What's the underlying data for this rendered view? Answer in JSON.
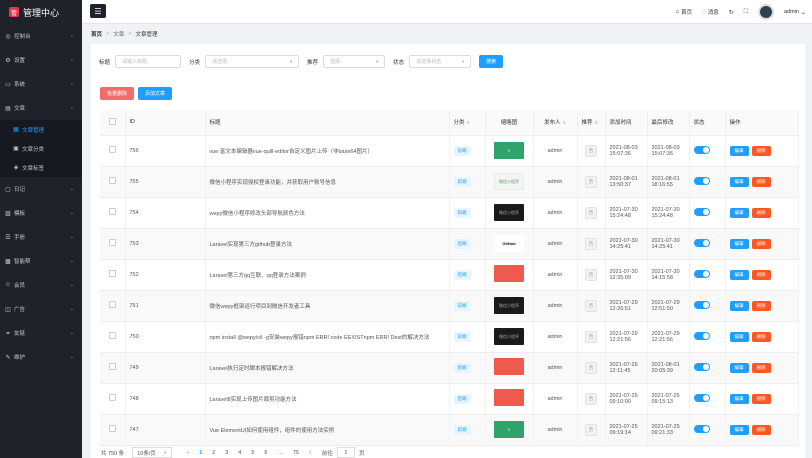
{
  "app": {
    "title": "管理中心",
    "logo_char": "管"
  },
  "sidebar": {
    "items": [
      {
        "icon": "dashboard-icon",
        "glyph": "◎",
        "label": "控制台"
      },
      {
        "icon": "settings-icon",
        "glyph": "⚙",
        "label": "设置"
      },
      {
        "icon": "monitor-icon",
        "glyph": "▭",
        "label": "系统"
      },
      {
        "icon": "article-icon",
        "glyph": "▤",
        "label": "文章"
      }
    ],
    "sub_items": [
      {
        "icon": "article-manage-icon",
        "glyph": "▦",
        "label": "文章管理"
      },
      {
        "icon": "category-icon",
        "glyph": "▣",
        "label": "文章分类"
      },
      {
        "icon": "tag-icon",
        "glyph": "◈",
        "label": "文章标签"
      }
    ],
    "items_after": [
      {
        "icon": "log-icon",
        "glyph": "▢",
        "label": "日记"
      },
      {
        "icon": "template-icon",
        "glyph": "▨",
        "label": "模板"
      },
      {
        "icon": "handbook-icon",
        "glyph": "☰",
        "label": "手册"
      },
      {
        "icon": "apps-icon",
        "glyph": "▩",
        "label": "智能帮"
      },
      {
        "icon": "member-icon",
        "glyph": "☺",
        "label": "会员"
      },
      {
        "icon": "ad-icon",
        "glyph": "◫",
        "label": "广告"
      },
      {
        "icon": "link-icon",
        "glyph": "⚭",
        "label": "友链"
      },
      {
        "icon": "maintain-icon",
        "glyph": "✎",
        "label": "维护"
      }
    ]
  },
  "header": {
    "home": "首页",
    "messages": "消息",
    "user": "admin"
  },
  "breadcrumb": {
    "home": "首页",
    "section": "文章",
    "current": "文章管理"
  },
  "filters": {
    "title_label": "标题",
    "title_placeholder": "请输入标题",
    "category_label": "分类",
    "category_placeholder": "请选择",
    "recommend_label": "推荐",
    "recommend_placeholder": "选择",
    "status_label": "状态",
    "status_placeholder": "请选择状态",
    "search_button": "搜索"
  },
  "actions": {
    "batch_delete": "批量删除",
    "add": "添加文章"
  },
  "table": {
    "headers": {
      "id": "ID",
      "title": "标题",
      "category": "分类",
      "thumb": "缩略图",
      "author": "发布人",
      "recommend": "推荐",
      "created": "添加时间",
      "updated": "最后修改",
      "status": "状态",
      "ops": "操作"
    },
    "edit_label": "编辑",
    "delete_label": "删除",
    "rows": [
      {
        "id": "756",
        "title": "vue 富文本编辑器vue-quill-editor自定义图片上传（非base64图片）",
        "category": "前端",
        "thumb_type": "green",
        "thumb_text": "V",
        "author": "admin",
        "recommend": "否",
        "created_date": "2021-08-03",
        "created_time": "15:07:36",
        "updated_date": "2021-08-03",
        "updated_time": "15:07:36"
      },
      {
        "id": "755",
        "title": "微信小程序实现授权登录功能，并获取用户账号信息",
        "category": "前端",
        "thumb_type": "light",
        "thumb_text": "微信小程序",
        "author": "admin",
        "recommend": "否",
        "created_date": "2021-08-01",
        "created_time": "13:50:37",
        "updated_date": "2021-08-01",
        "updated_time": "18:16:55"
      },
      {
        "id": "754",
        "title": "wepy微信小程序修改头部导航颜色方法",
        "category": "前端",
        "thumb_type": "dark",
        "thumb_text": "微信小程序",
        "author": "admin",
        "recommend": "否",
        "created_date": "2021-07-30",
        "created_time": "15:24:48",
        "updated_date": "2021-07-30",
        "updated_time": "15:24:48"
      },
      {
        "id": "753",
        "title": "Laravel实现第三方github登录方法",
        "category": "后端",
        "thumb_type": "github",
        "thumb_text": "GitHub",
        "author": "admin",
        "recommend": "否",
        "created_date": "2021-07-30",
        "created_time": "14:25:41",
        "updated_date": "2021-07-30",
        "updated_time": "14:25:41"
      },
      {
        "id": "752",
        "title": "Laravel第三方qq互联、qq登录方法案例",
        "category": "后端",
        "thumb_type": "red",
        "thumb_text": "",
        "author": "admin",
        "recommend": "否",
        "created_date": "2021-07-30",
        "created_time": "12:35:09",
        "updated_date": "2021-07-30",
        "updated_time": "14:15:58"
      },
      {
        "id": "751",
        "title": "微信wepy框架运行项目到微信开发者工具",
        "category": "前端",
        "thumb_type": "dark",
        "thumb_text": "微信小程序",
        "author": "admin",
        "recommend": "否",
        "created_date": "2021-07-29",
        "created_time": "12:26:51",
        "updated_date": "2021-07-29",
        "updated_time": "12:51:50"
      },
      {
        "id": "750",
        "title": "npm install @wepy/cli -g安装wepy报错npm ERR! code EEXISTnpm ERR! Dest的解决方法",
        "category": "前端",
        "thumb_type": "dark",
        "thumb_text": "微信小程序",
        "author": "admin",
        "recommend": "否",
        "created_date": "2021-07-29",
        "created_time": "12:21:56",
        "updated_date": "2021-07-29",
        "updated_time": "12:21:56"
      },
      {
        "id": "749",
        "title": "Laravel执行定时脚本报错解决方法",
        "category": "后端",
        "thumb_type": "red",
        "thumb_text": "",
        "author": "admin",
        "recommend": "否",
        "created_date": "2021-07-26",
        "created_time": "12:11:45",
        "updated_date": "2021-08-01",
        "updated_time": "20:05:39"
      },
      {
        "id": "748",
        "title": "Laravel8实现上传图片裁剪功能方法",
        "category": "后端",
        "thumb_type": "red",
        "thumb_text": "",
        "author": "admin",
        "recommend": "否",
        "created_date": "2021-07-26",
        "created_time": "09:10:00",
        "updated_date": "2021-07-26",
        "updated_time": "09:15:13"
      },
      {
        "id": "747",
        "title": "Vue ElementUI如何使用组件，组件的使用方法实例",
        "category": "前端",
        "thumb_type": "green",
        "thumb_text": "V",
        "author": "admin",
        "recommend": "否",
        "created_date": "2021-07-25",
        "created_time": "09:19:14",
        "updated_date": "2021-07-25",
        "updated_time": "09:21:33"
      }
    ]
  },
  "pagination": {
    "total": "共 750 条",
    "page_size": "10条/页",
    "prev": "‹",
    "pages": [
      "1",
      "2",
      "3",
      "4",
      "5",
      "6",
      "…",
      "75"
    ],
    "next": "›",
    "goto_label": "前往",
    "goto_value": "1",
    "page_unit": "页"
  }
}
